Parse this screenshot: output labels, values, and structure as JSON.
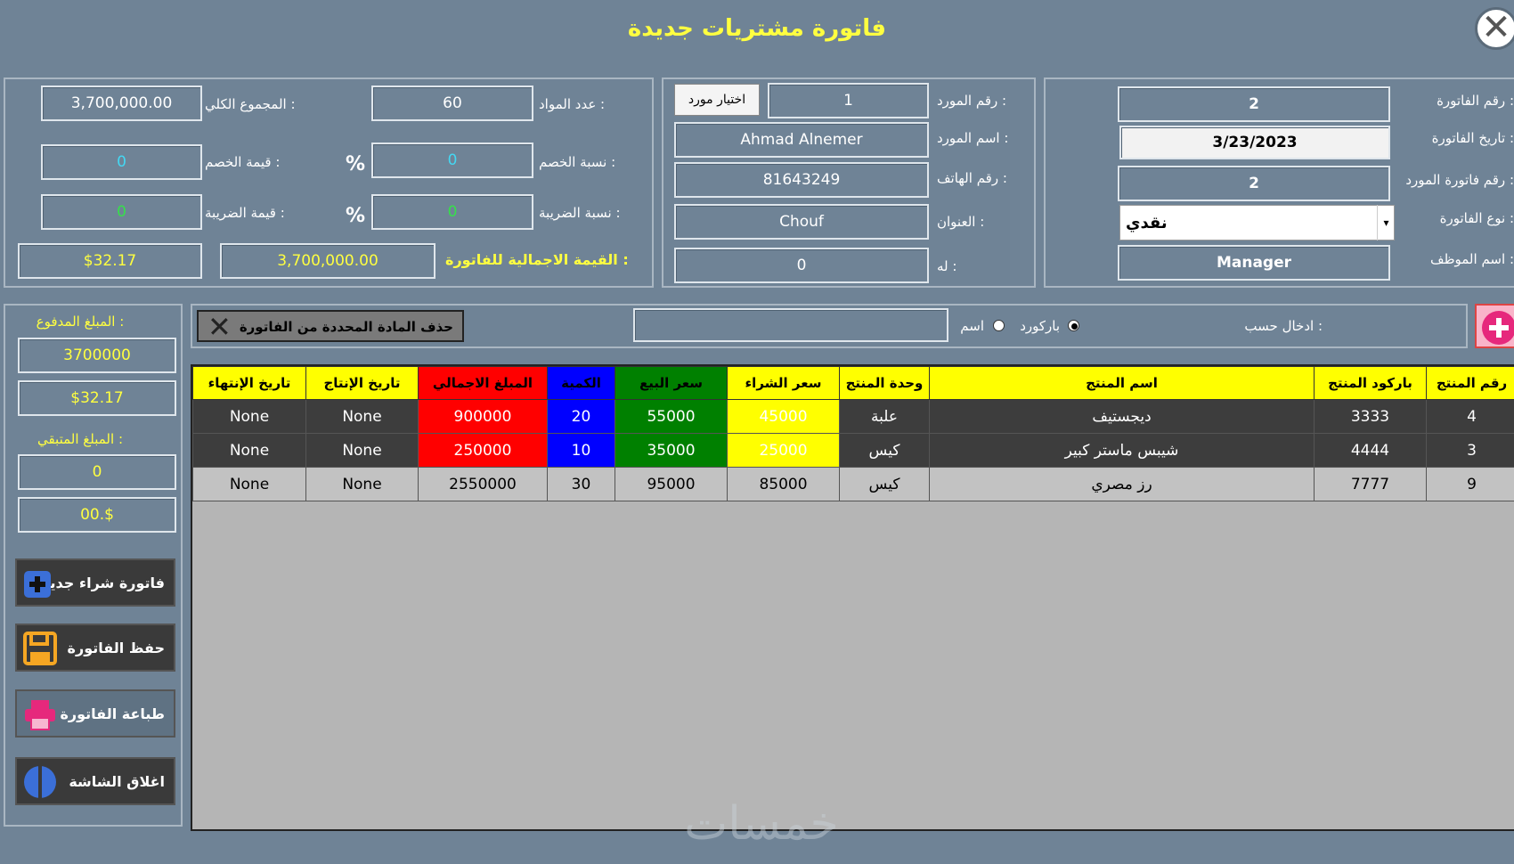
{
  "window": {
    "title": "فاتورة مشتريات جديدة",
    "close_icon": "close-icon"
  },
  "invoice_panel": {
    "invoice_number_label": "رقم الفاتورة :",
    "invoice_number": "2",
    "invoice_date_label": "تاريخ الفاتورة :",
    "invoice_date": "3/23/2023",
    "supplier_invoice_number_label": "رقم فاتورة المورد :",
    "supplier_invoice_number": "2",
    "invoice_type_label": "نوع الفاتورة :",
    "invoice_type": "نقدي",
    "employee_name_label": "اسم الموظف :",
    "employee_name": "Manager"
  },
  "supplier_panel": {
    "supplier_number_label": "رقم المورد :",
    "supplier_number": "1",
    "choose_supplier_label": "اختيار مورد",
    "supplier_name_label": "اسم المورد :",
    "supplier_name": "Ahmad Alnemer",
    "phone_label": "رقم الهاتف :",
    "phone": "81643249",
    "address_label": "العنوان :",
    "address": "Chouf",
    "balance_label": "له :",
    "balance": "0"
  },
  "totals_panel": {
    "items_count_label": "عدد المواد :",
    "items_count": "60",
    "grand_total_label": "المجموع الكلي :",
    "grand_total": "3,700,000.00",
    "discount_rate_label": "نسبة الخصم :",
    "discount_rate": "0",
    "discount_value_label": "قيمة الخصم :",
    "discount_value": "0",
    "tax_rate_label": "نسبة الضريبة :",
    "tax_rate": "0",
    "tax_value_label": "قيمة الضريبة :",
    "tax_value": "0",
    "percent_sign": "%",
    "invoice_total_label": "القيمة الاجمالية للفاتورة :",
    "invoice_total": "3,700,000.00",
    "invoice_total_usd": "$32.17"
  },
  "search_bar": {
    "delete_item_label": "حذف المادة المحددة من الفاتورة",
    "search_value": "",
    "name_option_label": "اسم",
    "barcode_option_label": "باركورد",
    "entry_by_label": "ادخال حسب :",
    "selected_option": "باركورد"
  },
  "payment_panel": {
    "paid_label": "المبلغ المدفوع :",
    "paid_amount": "3700000",
    "paid_usd": "$32.17",
    "remaining_label": "المبلغ المتبقي :",
    "remaining_amount": "0",
    "remaining_usd": "00.$"
  },
  "side_buttons": {
    "new_invoice": "فاتورة شراء جديدة",
    "save_invoice": "حفظ الفاتورة",
    "print_invoice": "طباعة الفاتورة",
    "close_screen": "اغلاق الشاشة"
  },
  "grid": {
    "columns": [
      "تاريخ الإنتهاء",
      "تاريخ الإنتاج",
      "المبلغ الاجمالي",
      "الكمية",
      "سعر البيع",
      "سعر الشراء",
      "وحدة المنتج",
      "اسم المنتج",
      "باركود المنتج",
      "رقم المنتج"
    ],
    "rows": [
      [
        "None",
        "None",
        "900000",
        "20",
        "55000",
        "45000",
        "علبة",
        "ديجستيف",
        "3333",
        "4"
      ],
      [
        "None",
        "None",
        "250000",
        "10",
        "35000",
        "25000",
        "كيس",
        "شيبس ماستر كبير",
        "4444",
        "3"
      ],
      [
        "None",
        "None",
        "2550000",
        "30",
        "95000",
        "85000",
        "كيس",
        "رز مصري",
        "7777",
        "9"
      ]
    ]
  },
  "watermark": "خمسات"
}
